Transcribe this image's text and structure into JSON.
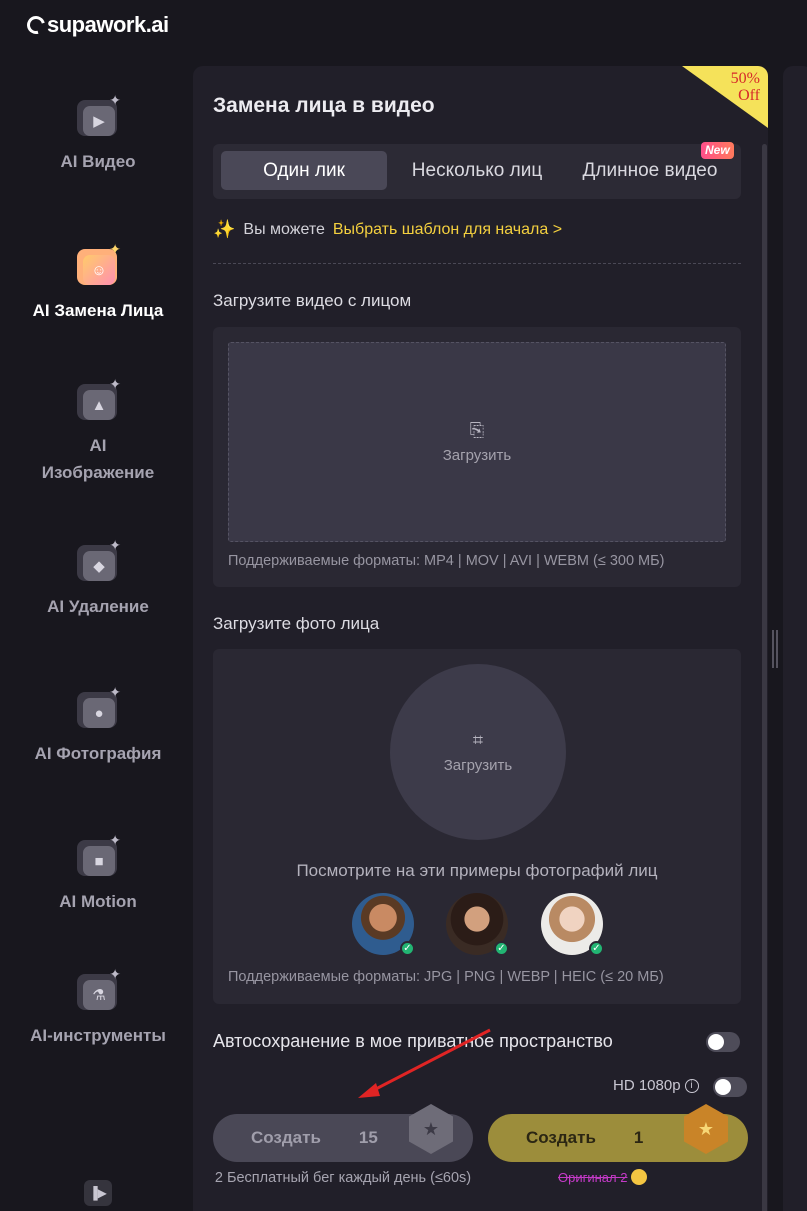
{
  "brand": {
    "name": "supawork.ai"
  },
  "sidebar": {
    "items": [
      {
        "label": "AI Видео",
        "icon": "video-icon"
      },
      {
        "label": "AI Замена Лица",
        "icon": "face-swap-icon",
        "active": true
      },
      {
        "label": "AI Изображение",
        "icon": "image-icon"
      },
      {
        "label": "AI Удаление",
        "icon": "eraser-icon"
      },
      {
        "label": "AI Фотография",
        "icon": "portrait-icon"
      },
      {
        "label": "AI Motion",
        "icon": "motion-camera-icon"
      },
      {
        "label": "AI-инструменты",
        "icon": "flask-icon"
      }
    ]
  },
  "promo": {
    "percent": "50%",
    "text": "Off"
  },
  "main": {
    "title": "Замена лица в видео",
    "tabs": [
      {
        "label": "Один лик",
        "active": true
      },
      {
        "label": "Несколько лиц"
      },
      {
        "label": "Длинное видео"
      }
    ],
    "new_badge": "New",
    "hint": {
      "prefix": "Вы можете",
      "link": "Выбрать шаблон для начала >"
    },
    "video_section": {
      "label": "Загрузите видео с лицом",
      "upload_text": "Загрузить",
      "formats": "Поддерживаемые форматы: MP4 | MOV | AVI | WEBM (≤ 300 МБ)"
    },
    "photo_section": {
      "label": "Загрузите фото лица",
      "upload_text": "Загрузить",
      "examples_label": "Посмотрите на эти примеры фотографий лиц",
      "formats": "Поддерживаемые форматы: JPG | PNG | WEBP | HEIC (≤ 20 МБ)"
    },
    "autosave_label": "Автосохранение в мое приватное пространство",
    "hd_label": "HD 1080p",
    "buttons": {
      "free": {
        "label": "Создать",
        "count": "15",
        "note": "2 Бесплатный бег каждый день (≤60s)"
      },
      "create": {
        "label": "Создать",
        "count": "1",
        "note": "Оригинал 2"
      }
    }
  },
  "colors": {
    "accent": "#f4d03f",
    "create_button": "#9c8d3b",
    "panel": "#211f29",
    "background": "#18171e"
  }
}
